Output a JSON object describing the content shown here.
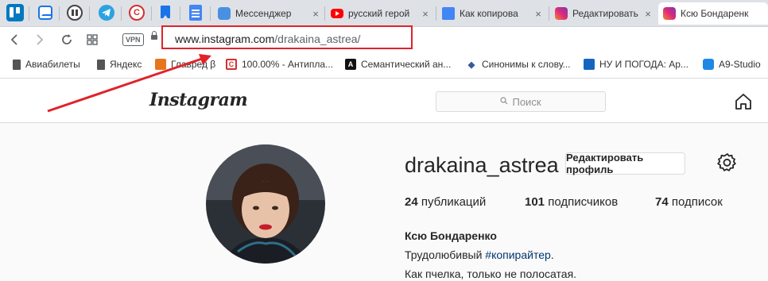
{
  "browser": {
    "pinned_tabs": [
      {
        "icon": "trello-icon",
        "color": "#0079bf"
      },
      {
        "icon": "mail-icon",
        "color": "#1a73e8"
      },
      {
        "icon": "pause-icon",
        "color": "#444444"
      },
      {
        "icon": "telegram-icon",
        "color": "#2aa3e0"
      },
      {
        "icon": "copyright-icon",
        "color": "#d32f2f"
      },
      {
        "icon": "bookmark-icon",
        "color": "#1a73e8"
      },
      {
        "icon": "docs-icon",
        "color": "#4285f4"
      }
    ],
    "tabs": [
      {
        "title": "Мессенджер",
        "icon": "messenger-icon",
        "color": "#4a90e2",
        "active": false
      },
      {
        "title": "русский герой",
        "icon": "youtube-icon",
        "color": "#ff0000",
        "active": false
      },
      {
        "title": "Как копирова",
        "icon": "docs-icon",
        "color": "#4285f4",
        "active": false
      },
      {
        "title": "Редактировать",
        "icon": "instagram-icon",
        "color": "#c13584",
        "active": false
      },
      {
        "title": "Ксю Бондаренк",
        "icon": "instagram-icon",
        "color": "#c13584",
        "active": true
      }
    ],
    "close_glyph": "×",
    "vpn_label": "VPN",
    "url_domain": "www.instagram.com",
    "url_path": "/drakaina_astrea/",
    "bookmarks": [
      {
        "label": "Авиабилеты",
        "icon": "file-icon",
        "color": "#555555"
      },
      {
        "label": "Яндекс",
        "icon": "file-icon",
        "color": "#555555"
      },
      {
        "label": "Главред β",
        "icon": "glavred-icon",
        "color": "#e8741c"
      },
      {
        "label": "100.00% - Антипла...",
        "icon": "copyright-icon",
        "color": "#d32f2f"
      },
      {
        "label": "Семантический ан...",
        "icon": "letter-a-icon",
        "color": "#111111"
      },
      {
        "label": "Синонимы к слову...",
        "icon": "shield-icon",
        "color": "#3b5998"
      },
      {
        "label": "НУ И ПОГОДА: Ар...",
        "icon": "weather-icon",
        "color": "#1565c0"
      },
      {
        "label": "A9-Studio",
        "icon": "a9-icon",
        "color": "#1e88e5"
      }
    ]
  },
  "instagram": {
    "logo": "Instagram",
    "search_placeholder": "Поиск",
    "username": "drakaina_astrea",
    "edit_profile": "Редактировать профиль",
    "stats": {
      "posts_count": "24",
      "posts_label": "публикаций",
      "followers_count": "101",
      "followers_label": "подписчиков",
      "following_count": "74",
      "following_label": "подписок"
    },
    "full_name": "Ксю Бондаренко",
    "bio_line1_text": "Трудолюбивый ",
    "bio_line1_tag": "#копирайтер",
    "bio_line1_end": ".",
    "bio_line2": "Как пчелка, только не полосатая."
  },
  "annotation": {
    "highlight_color": "#e0232a"
  }
}
